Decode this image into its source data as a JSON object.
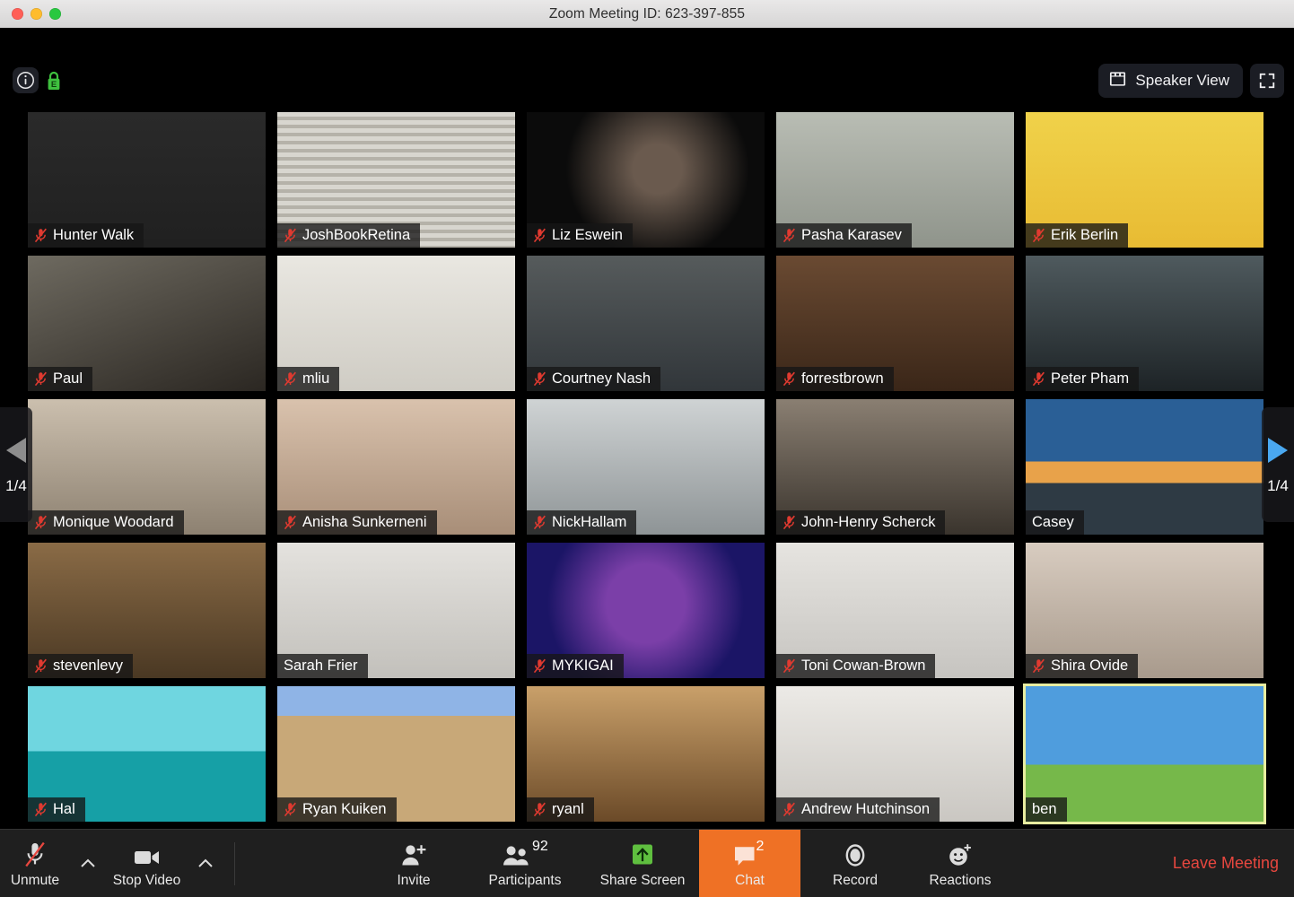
{
  "window": {
    "title": "Zoom Meeting ID: 623-397-855",
    "traffic_lights": [
      "close-button",
      "minimize-button",
      "maximize-button"
    ]
  },
  "topbar": {
    "info_icon": "info-icon",
    "encryption_icon": "green-lock-icon",
    "view_button_label": "Speaker View",
    "view_button_icon": "grid-view-icon",
    "fullscreen_icon": "enter-fullscreen-icon"
  },
  "gallery": {
    "page_indicator_left": "1/4",
    "page_indicator_right": "1/4",
    "prev_arrow_icon": "left-triangle-icon",
    "next_arrow_icon": "right-triangle-icon",
    "prev_arrow_color": "#8d8d8d",
    "next_arrow_color": "#4aa8f0",
    "active_speaker_border": "#e8eda0",
    "participants": [
      {
        "name": "Hunter Walk",
        "muted": true,
        "active": false
      },
      {
        "name": "JoshBookRetina",
        "muted": true,
        "active": false
      },
      {
        "name": "Liz Eswein",
        "muted": true,
        "active": false
      },
      {
        "name": "Pasha Karasev",
        "muted": true,
        "active": false
      },
      {
        "name": "Erik Berlin",
        "muted": true,
        "active": false
      },
      {
        "name": "Paul",
        "muted": true,
        "active": false
      },
      {
        "name": "mliu",
        "muted": true,
        "active": false
      },
      {
        "name": "Courtney Nash",
        "muted": true,
        "active": false
      },
      {
        "name": "forrestbrown",
        "muted": true,
        "active": false
      },
      {
        "name": "Peter Pham",
        "muted": true,
        "active": false
      },
      {
        "name": "Monique Woodard",
        "muted": true,
        "active": false
      },
      {
        "name": "Anisha Sunkerneni",
        "muted": true,
        "active": false
      },
      {
        "name": "NickHallam",
        "muted": true,
        "active": false
      },
      {
        "name": "John-Henry Scherck",
        "muted": true,
        "active": false
      },
      {
        "name": "Casey",
        "muted": false,
        "active": false
      },
      {
        "name": "stevenlevy",
        "muted": true,
        "active": false
      },
      {
        "name": "Sarah Frier",
        "muted": false,
        "active": false
      },
      {
        "name": "MYKIGAI",
        "muted": true,
        "active": false
      },
      {
        "name": "Toni Cowan-Brown",
        "muted": true,
        "active": false
      },
      {
        "name": "Shira Ovide",
        "muted": true,
        "active": false
      },
      {
        "name": "Hal",
        "muted": true,
        "active": false
      },
      {
        "name": "Ryan Kuiken",
        "muted": true,
        "active": false
      },
      {
        "name": "ryanl",
        "muted": true,
        "active": false
      },
      {
        "name": "Andrew Hutchinson",
        "muted": true,
        "active": false
      },
      {
        "name": "ben",
        "muted": false,
        "active": true
      }
    ]
  },
  "toolbar": {
    "mute_label": "Unmute",
    "mute_icon": "muted-microphone-icon",
    "video_label": "Stop Video",
    "video_icon": "camera-icon",
    "invite_label": "Invite",
    "invite_icon": "add-person-icon",
    "participants_label": "Participants",
    "participants_icon": "people-icon",
    "participants_count": "92",
    "share_label": "Share Screen",
    "share_icon": "share-screen-up-arrow-icon",
    "share_accent": "#5fbf3f",
    "chat_label": "Chat",
    "chat_icon": "chat-bubble-icon",
    "chat_count": "2",
    "chat_accent": "#ef7125",
    "record_label": "Record",
    "record_icon": "record-circle-icon",
    "reactions_label": "Reactions",
    "reactions_icon": "smiley-plus-icon",
    "leave_label": "Leave Meeting",
    "leave_color": "#e8473f"
  }
}
